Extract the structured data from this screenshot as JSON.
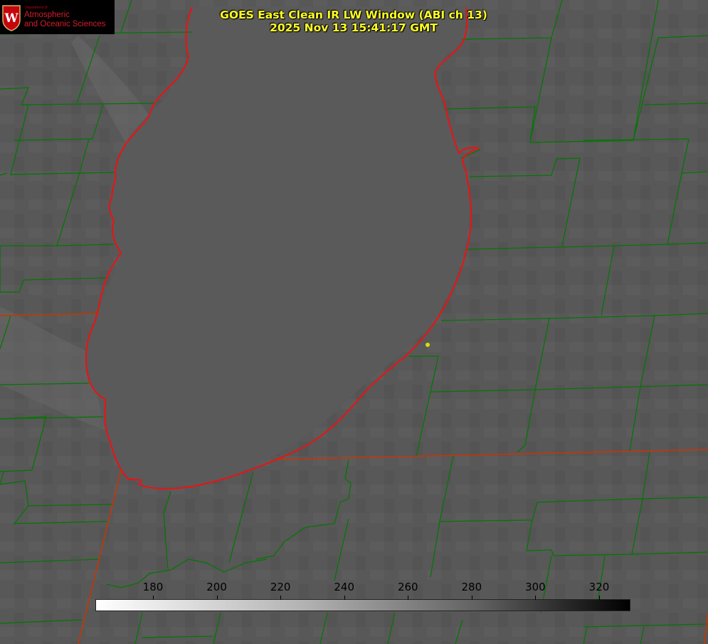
{
  "title": {
    "line1": "GOES East Clean IR LW Window (ABI ch 13)",
    "line2": "2025 Nov 13 15:41:17 GMT"
  },
  "logo": {
    "small_text": "Department of",
    "line1": "Atmospheric",
    "line2": "and Oceanic Sciences",
    "seal_letter": "W"
  },
  "colorbar": {
    "tick_labels": [
      "180",
      "200",
      "220",
      "240",
      "260",
      "280",
      "300",
      "320"
    ],
    "tick_values": [
      180,
      200,
      220,
      240,
      260,
      280,
      300,
      320
    ],
    "colormap": "white to black (warm is dark)"
  },
  "map": {
    "lake_outline_color": "#ee1111",
    "county_line_color": "#007700",
    "state_line_color": "#cc3300",
    "marker_color": "#dddd00"
  }
}
